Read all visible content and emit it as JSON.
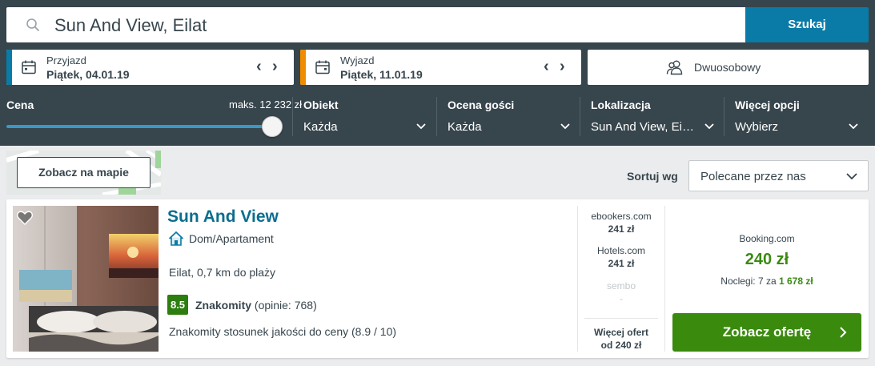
{
  "search": {
    "value": "Sun And View, Eilat",
    "button_label": "Szukaj"
  },
  "checkin": {
    "label": "Przyjazd",
    "value": "Piątek, 04.01.19",
    "prev": "‹",
    "next": "›",
    "accent_color": "#0a7ba7"
  },
  "checkout": {
    "label": "Wyjazd",
    "value": "Piątek, 11.01.19",
    "prev": "‹",
    "next": "›",
    "accent_color": "#f08c00"
  },
  "room": {
    "label": "Dwuosobowy"
  },
  "filters": {
    "price": {
      "title": "Cena",
      "max_label": "maks. 12 232 zł",
      "slider_level": 1.0
    },
    "property": {
      "title": "Obiekt",
      "value": "Każda"
    },
    "guest_rating": {
      "title": "Ocena gości",
      "value": "Każda"
    },
    "location": {
      "title": "Lokalizacja",
      "value": "Sun And View, Ei…"
    },
    "more": {
      "title": "Więcej opcji",
      "value": "Wybierz"
    }
  },
  "map": {
    "button_label": "Zobacz na mapie"
  },
  "sort": {
    "label": "Sortuj wg",
    "value": "Polecane przez nas"
  },
  "result": {
    "name": "Sun And View",
    "type": "Dom/Apartament",
    "location": "Eilat, 0,7 km do plaży",
    "score": "8.5",
    "rating_label": "Znakomity",
    "rating_count": "(opinie: 768)",
    "value_note": "Znakomity stosunek jakości do ceny (8.9 / 10)",
    "providers": [
      {
        "name": "ebookers.com",
        "price": "241 zł"
      },
      {
        "name": "Hotels.com",
        "price": "241 zł"
      },
      {
        "name": "sembo",
        "price": "-"
      }
    ],
    "more_offers_line1": "Więcej ofert",
    "more_offers_line2": "od 240 zł",
    "deal": {
      "site": "Booking.com",
      "price": "240 zł",
      "nights_prefix": "Noclegi: 7 za",
      "nights_total": "1 678 zł",
      "button_label": "Zobacz ofertę"
    }
  },
  "colors": {
    "topbar": "#37454d",
    "primary": "#0a7ba7",
    "deal_green": "#3a8a0d",
    "hotel_link": "#0a6e8f"
  }
}
